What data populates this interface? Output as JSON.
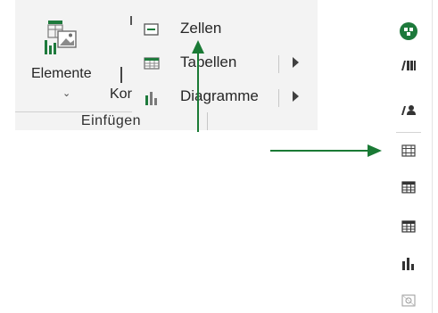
{
  "ribbon": {
    "elements_button_label": "Elemente",
    "partial_label": "Kor",
    "group_label": "Einfügen"
  },
  "menu": {
    "items": [
      {
        "label": "Zellen",
        "icon": "cell-icon",
        "has_submenu": false
      },
      {
        "label": "Tabellen",
        "icon": "table-icon",
        "has_submenu": true
      },
      {
        "label": "Diagramme",
        "icon": "chart-icon",
        "has_submenu": true
      }
    ]
  },
  "sidebar": {
    "icons": [
      "add-element-icon",
      "library-icon",
      "users-icon",
      "cell-icon",
      "table-icon",
      "table-icon",
      "bar-chart-icon",
      "image-placeholder-icon"
    ]
  },
  "colors": {
    "accent_green": "#1e7a3c",
    "arrow_green": "#1a7a35",
    "ribbon_bg": "#f3f3f3"
  }
}
